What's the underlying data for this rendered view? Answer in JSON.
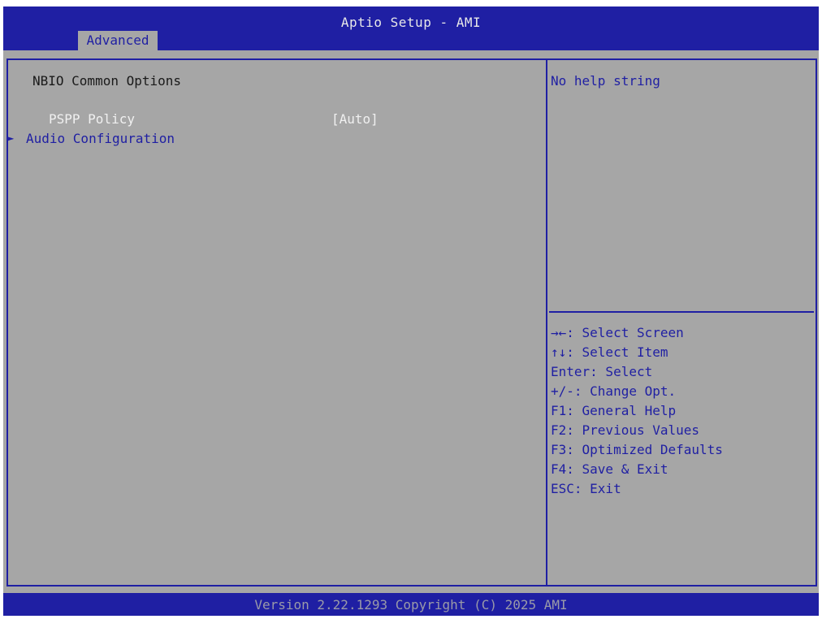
{
  "header": {
    "title": "Aptio Setup - AMI",
    "tabs": [
      {
        "label": "Advanced",
        "active": true
      }
    ]
  },
  "main": {
    "section_title": "NBIO Common Options",
    "items": [
      {
        "label": "PSPP Policy",
        "value": "[Auto]",
        "type": "option",
        "selected": true
      },
      {
        "label": "Audio Configuration",
        "type": "submenu",
        "arrow": "►"
      }
    ]
  },
  "help": {
    "text": "No help string",
    "keys": [
      "→←: Select Screen",
      "↑↓: Select Item",
      "Enter: Select",
      "+/-: Change Opt.",
      "F1: General Help",
      "F2: Previous Values",
      "F3: Optimized Defaults",
      "F4: Save & Exit",
      "ESC: Exit"
    ]
  },
  "footer": {
    "text": "Version 2.22.1293 Copyright (C) 2025 AMI"
  },
  "colors": {
    "bios_blue": "#1f1fa3",
    "panel_gray": "#a6a6a6",
    "highlight_white": "#f0f0f0",
    "footer_text": "#9a9aa8"
  }
}
